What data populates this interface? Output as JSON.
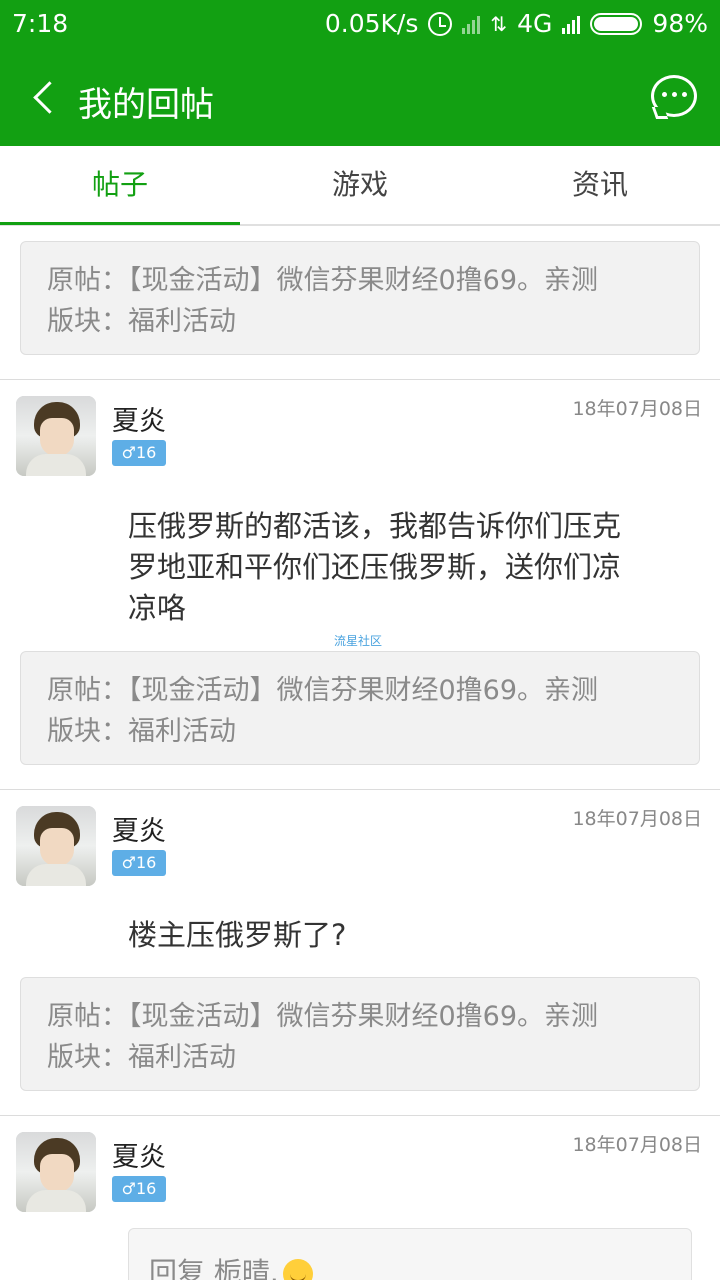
{
  "status_bar": {
    "time": "7:18",
    "speed": "0.05K/s",
    "network": "4G",
    "battery": "98%",
    "battery_level": 0.98
  },
  "header": {
    "title": "我的回帖",
    "back_icon": "chevron-left-icon",
    "chat_icon": "chat-bubble-icon"
  },
  "tabs": [
    {
      "label": "帖子",
      "active": true
    },
    {
      "label": "游戏",
      "active": false
    },
    {
      "label": "资讯",
      "active": false
    }
  ],
  "top_quote": {
    "original": "原帖：【现金活动】微信芬果财经0撸69。亲测",
    "board": "版块：福利活动"
  },
  "posts": [
    {
      "username": "夏炎",
      "badge": "♂16",
      "date": "18年07月08日",
      "reply_lines": [
        "压俄罗斯的都活该，我都告诉你们压克",
        "罗地亚和平你们还压俄罗斯，送你们凉",
        "凉咯"
      ],
      "watermark": "流星社区",
      "quote_original": "原帖：【现金活动】微信芬果财经0撸69。亲测",
      "quote_board": "版块：福利活动"
    },
    {
      "username": "夏炎",
      "badge": "♂16",
      "date": "18年07月08日",
      "reply_lines": [
        "楼主压俄罗斯了?"
      ],
      "quote_original": "原帖：【现金活动】微信芬果财经0撸69。亲测",
      "quote_board": "版块：福利活动"
    },
    {
      "username": "夏炎",
      "badge": "♂16",
      "date": "18年07月08日",
      "nested_reply": "回复 栀晴."
    }
  ],
  "colors": {
    "brand_green": "#12a012",
    "badge_blue": "#5eaee6",
    "quote_bg": "#f2f2f2"
  }
}
